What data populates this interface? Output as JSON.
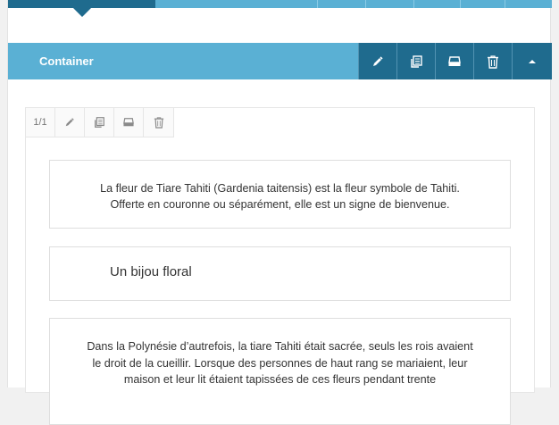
{
  "container": {
    "title": "Container",
    "tools": [
      {
        "name": "edit-icon"
      },
      {
        "name": "clone-icon"
      },
      {
        "name": "paint-icon"
      },
      {
        "name": "trash-icon"
      },
      {
        "name": "collapse-icon"
      }
    ]
  },
  "column": {
    "size_label": "1/1",
    "tools": [
      {
        "name": "edit-icon"
      },
      {
        "name": "clone-icon"
      },
      {
        "name": "paint-icon"
      },
      {
        "name": "trash-icon"
      }
    ]
  },
  "elements": {
    "text1": {
      "line1": "La fleur de Tiare Tahiti (Gardenia taitensis) est la fleur symbole de Tahiti.",
      "line2": "Offerte en couronne ou séparément, elle est un signe de bienvenue."
    },
    "heading": "Un bijou floral",
    "text2": {
      "line1": "Dans la Polynésie d’autrefois, la tiare Tahiti était sacrée, seuls les rois avaient",
      "line2": "le droit de la cueillir. Lorsque des personnes de haut rang se mariaient, leur",
      "line3": "maison et leur lit étaient tapissées de ces fleurs pendant trente"
    }
  },
  "colors": {
    "header_light": "#5ab0d4",
    "header_dark": "#1f6b8e"
  }
}
